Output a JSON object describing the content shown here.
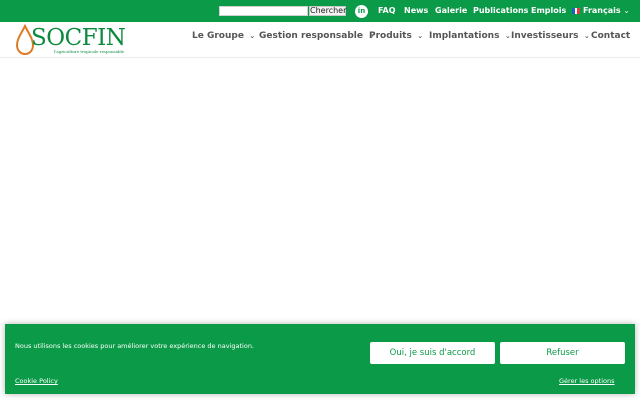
{
  "topbar": {
    "search_placeholder": "",
    "search_button": "Chercher",
    "linkedin_label": "in",
    "links": [
      "FAQ",
      "News",
      "Galerie",
      "Publications",
      "Emplois"
    ],
    "language": "Français"
  },
  "header": {
    "logo_text": "SOCFIN",
    "logo_tagline": "l'agriculture tropicale responsable",
    "nav": [
      "Le Groupe",
      "Gestion responsable",
      "Produits",
      "Implantations",
      "Investisseurs",
      "Contact"
    ]
  },
  "cookie": {
    "message": "Nous utilisons les cookies pour améliorer votre expérience de navigation.",
    "accept": "Oui, je suis d'accord",
    "refuse": "Refuser",
    "policy": "Cookie Policy",
    "options": "Gérer les options"
  },
  "colors": {
    "brand_green": "#0b9a47",
    "logo_orange": "#e07a22"
  },
  "icons": {
    "social": "linkedin-icon",
    "flag": "french-flag-icon",
    "dropdown": "chevron-down-icon"
  }
}
